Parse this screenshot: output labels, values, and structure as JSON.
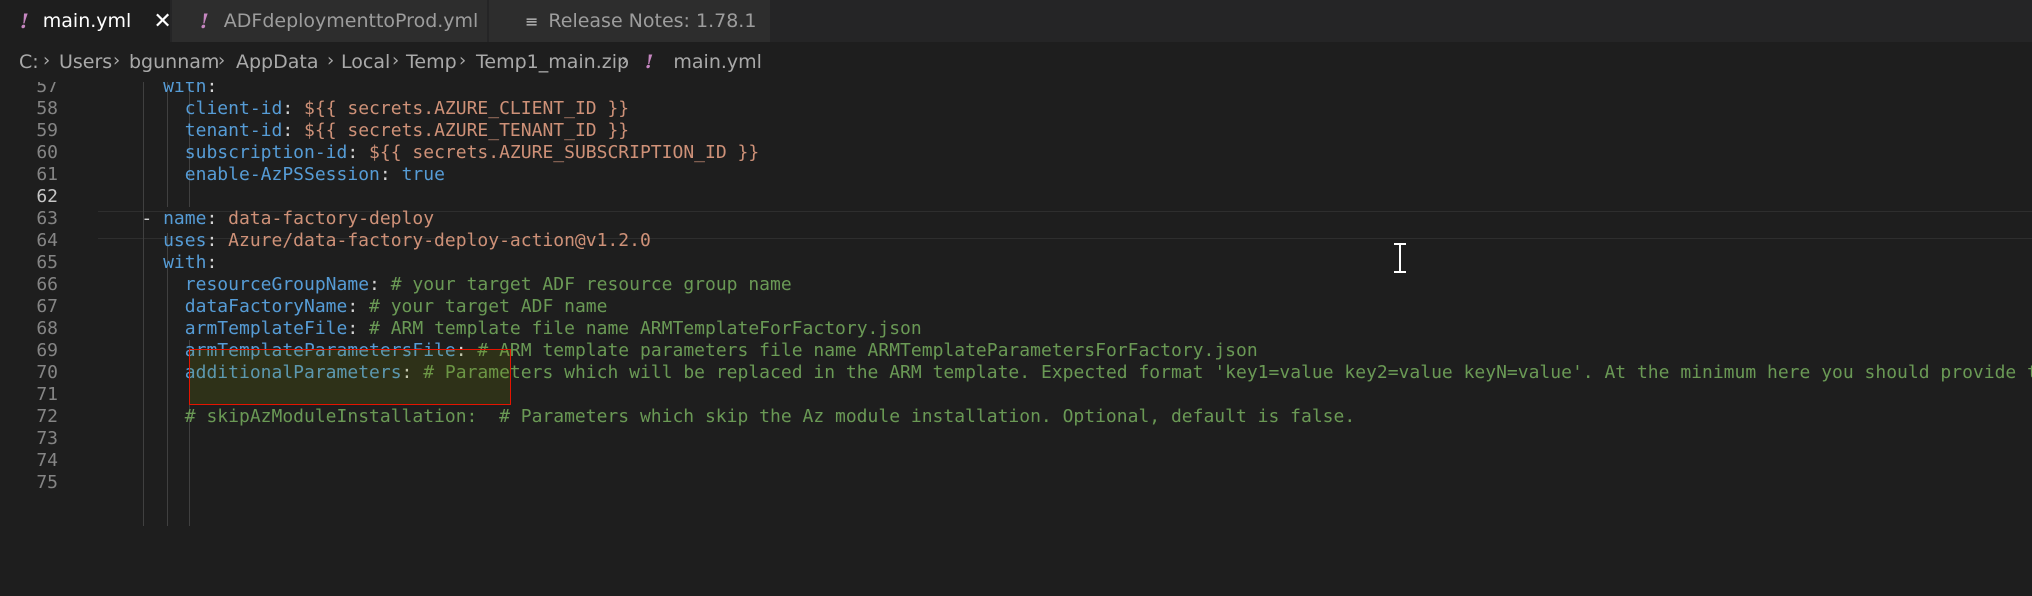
{
  "tabs": [
    {
      "label": "main.yml",
      "icon": "yaml-exclamation-icon",
      "active": true,
      "close": "✕"
    },
    {
      "label": "ADFdeploymenttoProd.yml",
      "icon": "yaml-exclamation-icon",
      "active": false
    },
    {
      "label": "Release Notes: 1.78.1",
      "icon": "document-lines-icon",
      "active": false
    }
  ],
  "breadcrumb": [
    "C:",
    "Users",
    "bgunnam",
    "AppData",
    "Local",
    "Temp",
    "Temp1_main.zip",
    "main.yml"
  ],
  "editor": {
    "lines": [
      {
        "n": "57",
        "indent": "      ",
        "parts": [
          [
            "k",
            "with"
          ],
          [
            "p",
            ":"
          ]
        ]
      },
      {
        "n": "58",
        "indent": "        ",
        "parts": [
          [
            "k",
            "client-id"
          ],
          [
            "p",
            ": "
          ],
          [
            "s",
            "${{ secrets.AZURE_CLIENT_ID }}"
          ]
        ]
      },
      {
        "n": "59",
        "indent": "        ",
        "parts": [
          [
            "k",
            "tenant-id"
          ],
          [
            "p",
            ": "
          ],
          [
            "s",
            "${{ secrets.AZURE_TENANT_ID }}"
          ]
        ]
      },
      {
        "n": "60",
        "indent": "        ",
        "parts": [
          [
            "k",
            "subscription-id"
          ],
          [
            "p",
            ": "
          ],
          [
            "s",
            "${{ secrets.AZURE_SUBSCRIPTION_ID }}"
          ]
        ]
      },
      {
        "n": "61",
        "indent": "        ",
        "parts": [
          [
            "k",
            "enable-AzPSSession"
          ],
          [
            "p",
            ": "
          ],
          [
            "k",
            "true"
          ]
        ]
      },
      {
        "n": "62",
        "indent": "",
        "parts": []
      },
      {
        "n": "63",
        "indent": "    ",
        "parts": [
          [
            "p",
            "- "
          ],
          [
            "k",
            "name"
          ],
          [
            "p",
            ": "
          ],
          [
            "s",
            "data-factory-deploy"
          ]
        ]
      },
      {
        "n": "64",
        "indent": "      ",
        "parts": [
          [
            "k",
            "uses"
          ],
          [
            "p",
            ": "
          ],
          [
            "s",
            "Azure/data-factory-deploy-action@v1.2.0"
          ]
        ]
      },
      {
        "n": "65",
        "indent": "      ",
        "parts": [
          [
            "k",
            "with"
          ],
          [
            "p",
            ":"
          ]
        ]
      },
      {
        "n": "66",
        "indent": "        ",
        "parts": [
          [
            "k",
            "resourceGroupName"
          ],
          [
            "p",
            ": "
          ],
          [
            "c",
            "# your target ADF resource group name"
          ]
        ]
      },
      {
        "n": "67",
        "indent": "        ",
        "parts": [
          [
            "k",
            "dataFactoryName"
          ],
          [
            "p",
            ": "
          ],
          [
            "c",
            "# your target ADF name"
          ]
        ]
      },
      {
        "n": "68",
        "indent": "        ",
        "parts": [
          [
            "k",
            "armTemplateFile"
          ],
          [
            "p",
            ": "
          ],
          [
            "c",
            "# ARM template file name ARMTemplateForFactory.json"
          ]
        ]
      },
      {
        "n": "69",
        "indent": "        ",
        "parts": [
          [
            "k",
            "armTemplateParametersFile"
          ],
          [
            "p",
            ": "
          ],
          [
            "c",
            "# ARM template parameters file name ARMTemplateParametersForFactory.json"
          ]
        ]
      },
      {
        "n": "70",
        "indent": "        ",
        "parts": [
          [
            "k",
            "additionalParameters"
          ],
          [
            "p",
            ": "
          ],
          [
            "c",
            "# Parameters which will be replaced in the ARM template. Expected format 'key1=value key2=value keyN=value'. At the minimum here you should provide the target ADF name parameter"
          ]
        ]
      },
      {
        "n": "71",
        "indent": "",
        "parts": []
      },
      {
        "n": "72",
        "indent": "        ",
        "parts": [
          [
            "c",
            "# skipAzModuleInstallation:  # Parameters which skip the Az module installation. Optional, default is false."
          ]
        ]
      },
      {
        "n": "73",
        "indent": "",
        "parts": []
      },
      {
        "n": "74",
        "indent": "",
        "parts": []
      },
      {
        "n": "75",
        "indent": "",
        "parts": []
      }
    ]
  },
  "colors": {
    "keyword": "#569cd6",
    "string": "#ce9178",
    "comment": "#6a9955",
    "highlight_border": "#e51400"
  }
}
